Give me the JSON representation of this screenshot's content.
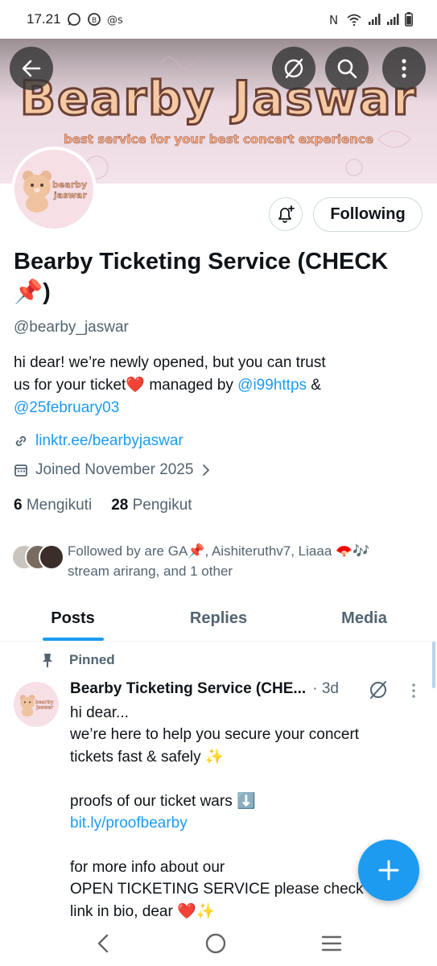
{
  "status_bar": {
    "time": "17.21",
    "left_icons": [
      "whatsapp-icon",
      "whatsapp-business-icon",
      "at-icon"
    ],
    "right_icons": [
      "nfc-icon",
      "wifi-icon",
      "signal-icon",
      "signal-icon",
      "battery-icon"
    ]
  },
  "banner": {
    "title": "Bearby Jaswar",
    "subtitle": "best service for your best concert experience"
  },
  "header_buttons": [
    "back-arrow-icon",
    "grok-icon",
    "search-icon",
    "more-vertical-icon"
  ],
  "avatar": {
    "logo_line1": "bearby",
    "logo_line2": "jaswar"
  },
  "actions": {
    "notify_icon": "bell-plus-icon",
    "following_label": "Following"
  },
  "profile": {
    "name": "Bearby Ticketing Service (CHECK 📌)",
    "handle": "@bearby_jaswar",
    "bio_line1": "hi dear! we’re newly opened, but you can trust",
    "bio_line2_pre": "us for your ticket❤️ managed by ",
    "bio_mention1": "@i99https",
    "bio_line2_post": " &",
    "bio_mention2": "@25february03",
    "website": "linktr.ee/bearbyjaswar",
    "joined": "Joined November 2025",
    "following_count": "6",
    "following_label": "Mengikuti",
    "followers_count": "28",
    "followers_label": "Pengikut",
    "followed_by": "Followed by are GA📌, Aishiteruthv7, Liaaa 🪭🎶 stream arirang, and 1 other"
  },
  "tabs": [
    {
      "label": "Posts",
      "active": true
    },
    {
      "label": "Replies",
      "active": false
    },
    {
      "label": "Media",
      "active": false
    }
  ],
  "pinned_post": {
    "pinned_label": "Pinned",
    "author": "Bearby Ticketing Service (CHE...",
    "time": "· 3d",
    "lines": [
      "hi dear...",
      "we’re here to help you secure your concert",
      "tickets fast & safely ✨",
      "",
      "proofs of our ticket wars ⬇️",
      "bit.ly/proofbearby",
      "",
      "for more info about our",
      "OPEN TICKETING SERVICE please check",
      "link in bio, dear ❤️✨"
    ]
  },
  "fab_icon": "plus-icon",
  "nav_bar": [
    "back-icon",
    "home-icon",
    "recents-icon"
  ],
  "colors": {
    "accent": "#1d9bf0",
    "text": "#0f1419",
    "secondary": "#536471",
    "banner_pink": "#f3e3ea"
  }
}
